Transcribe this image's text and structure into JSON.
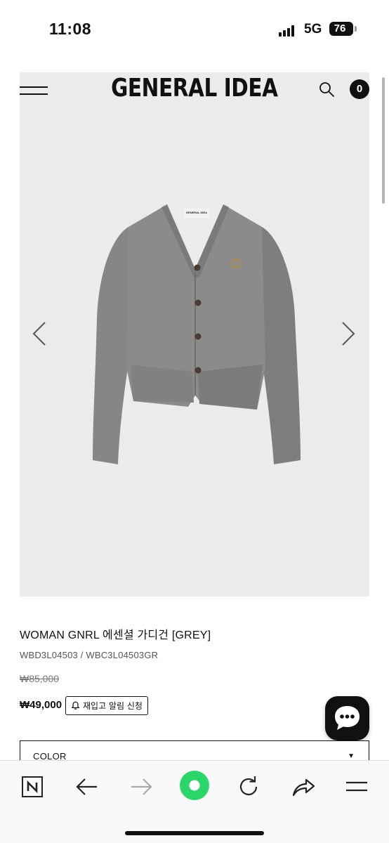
{
  "status_bar": {
    "time": "11:08",
    "network": "5G",
    "battery": "76"
  },
  "header": {
    "brand": "GENERAL IDEA",
    "cart_count": "0"
  },
  "product": {
    "name": "WOMAN GNRL 에센셜 가디건 [GREY]",
    "code": "WBD3L04503 / WBC3L04503GR",
    "original_price": "₩85,000",
    "sale_price": "₩49,000",
    "restock_label": "재입고 알림 신청",
    "garment_tag": "GENERAL IDEA",
    "color": "#8a8a8a"
  },
  "options": {
    "color_label": "COLOR",
    "caret": "▼"
  },
  "browser_toolbar": {
    "items": [
      "naver-logo-icon",
      "back-arrow-icon",
      "forward-arrow-icon",
      "green-home-icon",
      "reload-icon",
      "share-icon",
      "menu-icon"
    ],
    "accent": "#2bd66a"
  }
}
